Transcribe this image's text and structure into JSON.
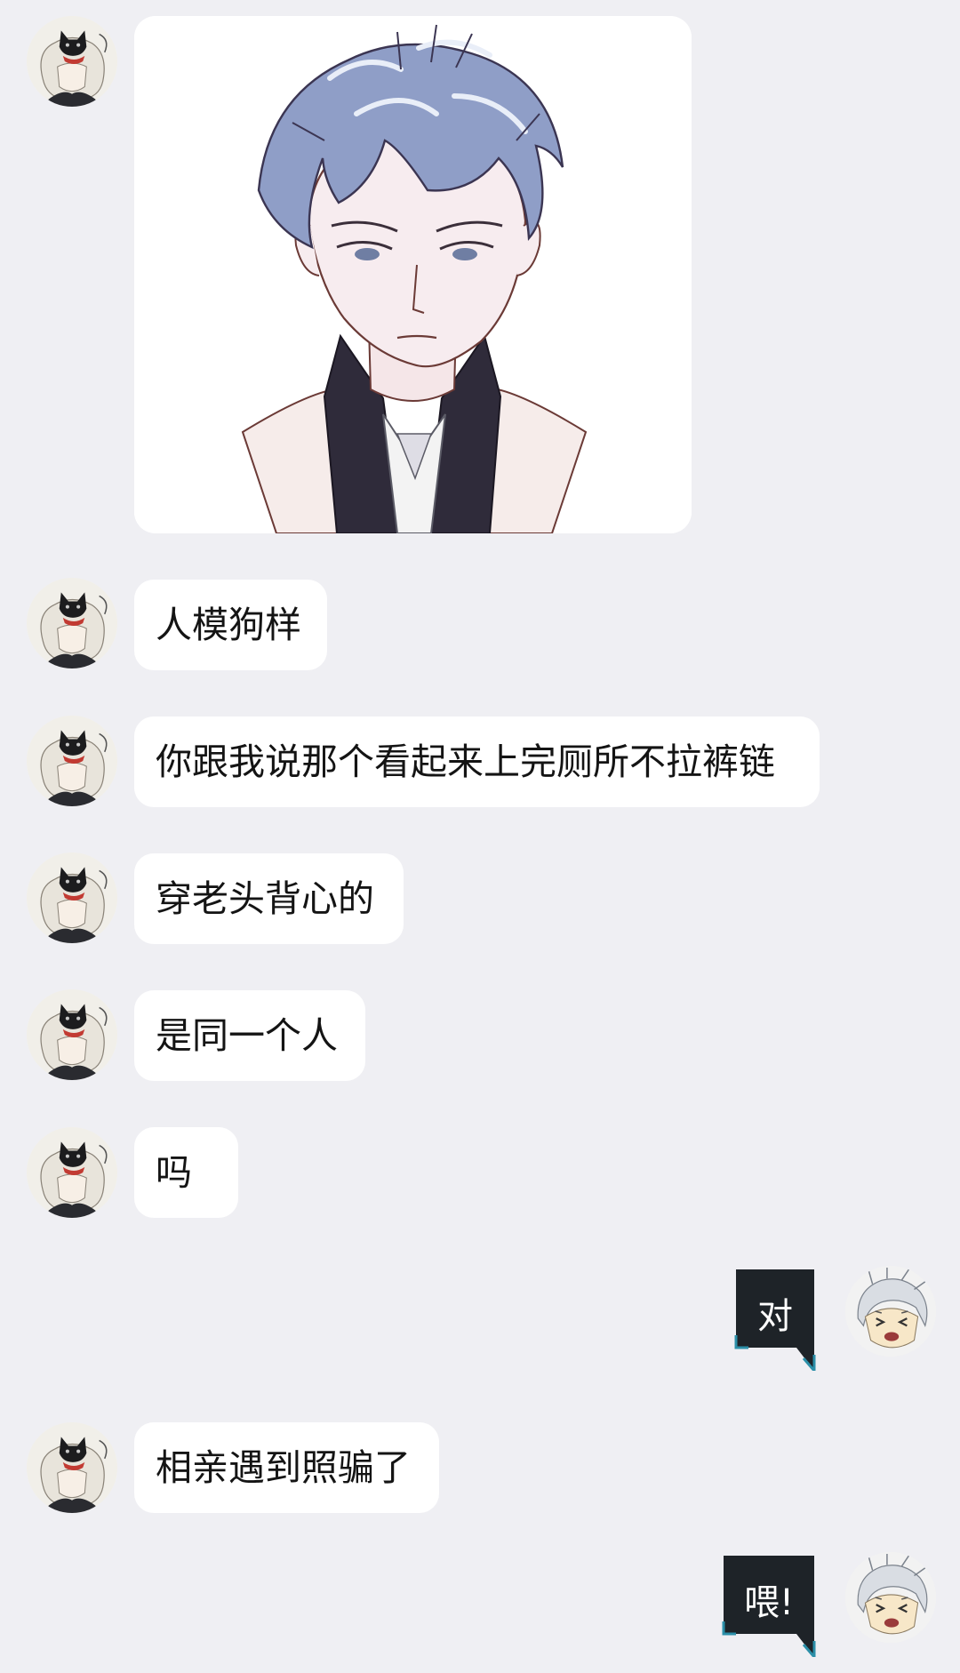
{
  "messages": {
    "m1": {
      "sender": "other",
      "type": "image",
      "content": "anime-sketch-man-in-suit"
    },
    "m2": {
      "sender": "other",
      "text": "人模狗样"
    },
    "m3": {
      "sender": "other",
      "text": "你跟我说那个看起来上完厕所不拉裤链"
    },
    "m4": {
      "sender": "other",
      "text": "穿老头背心的"
    },
    "m5": {
      "sender": "other",
      "text": "是同一个人"
    },
    "m6": {
      "sender": "other",
      "text": "吗"
    },
    "m7": {
      "sender": "self",
      "text": "对"
    },
    "m8": {
      "sender": "other",
      "text": "相亲遇到照骗了"
    },
    "m9": {
      "sender": "self",
      "text": "喂!"
    }
  },
  "colors": {
    "background": "#efeff3",
    "other_bubble": "#ffffff",
    "self_bubble": "#1e2328",
    "self_bubble_accent": "#2b8fa8"
  },
  "icons": {
    "other_avatar": "avatar-black-cat-white-hair",
    "self_avatar": "avatar-white-hair-crying"
  }
}
